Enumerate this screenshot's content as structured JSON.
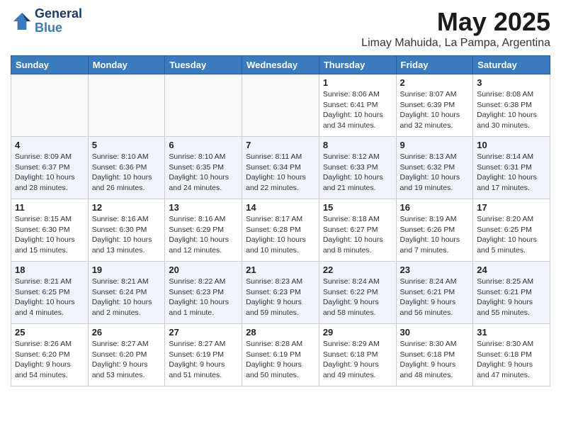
{
  "header": {
    "logo_line1": "General",
    "logo_line2": "Blue",
    "month_year": "May 2025",
    "location": "Limay Mahuida, La Pampa, Argentina"
  },
  "days_of_week": [
    "Sunday",
    "Monday",
    "Tuesday",
    "Wednesday",
    "Thursday",
    "Friday",
    "Saturday"
  ],
  "weeks": [
    [
      {
        "day": "",
        "info": ""
      },
      {
        "day": "",
        "info": ""
      },
      {
        "day": "",
        "info": ""
      },
      {
        "day": "",
        "info": ""
      },
      {
        "day": "1",
        "info": "Sunrise: 8:06 AM\nSunset: 6:41 PM\nDaylight: 10 hours\nand 34 minutes."
      },
      {
        "day": "2",
        "info": "Sunrise: 8:07 AM\nSunset: 6:39 PM\nDaylight: 10 hours\nand 32 minutes."
      },
      {
        "day": "3",
        "info": "Sunrise: 8:08 AM\nSunset: 6:38 PM\nDaylight: 10 hours\nand 30 minutes."
      }
    ],
    [
      {
        "day": "4",
        "info": "Sunrise: 8:09 AM\nSunset: 6:37 PM\nDaylight: 10 hours\nand 28 minutes."
      },
      {
        "day": "5",
        "info": "Sunrise: 8:10 AM\nSunset: 6:36 PM\nDaylight: 10 hours\nand 26 minutes."
      },
      {
        "day": "6",
        "info": "Sunrise: 8:10 AM\nSunset: 6:35 PM\nDaylight: 10 hours\nand 24 minutes."
      },
      {
        "day": "7",
        "info": "Sunrise: 8:11 AM\nSunset: 6:34 PM\nDaylight: 10 hours\nand 22 minutes."
      },
      {
        "day": "8",
        "info": "Sunrise: 8:12 AM\nSunset: 6:33 PM\nDaylight: 10 hours\nand 21 minutes."
      },
      {
        "day": "9",
        "info": "Sunrise: 8:13 AM\nSunset: 6:32 PM\nDaylight: 10 hours\nand 19 minutes."
      },
      {
        "day": "10",
        "info": "Sunrise: 8:14 AM\nSunset: 6:31 PM\nDaylight: 10 hours\nand 17 minutes."
      }
    ],
    [
      {
        "day": "11",
        "info": "Sunrise: 8:15 AM\nSunset: 6:30 PM\nDaylight: 10 hours\nand 15 minutes."
      },
      {
        "day": "12",
        "info": "Sunrise: 8:16 AM\nSunset: 6:30 PM\nDaylight: 10 hours\nand 13 minutes."
      },
      {
        "day": "13",
        "info": "Sunrise: 8:16 AM\nSunset: 6:29 PM\nDaylight: 10 hours\nand 12 minutes."
      },
      {
        "day": "14",
        "info": "Sunrise: 8:17 AM\nSunset: 6:28 PM\nDaylight: 10 hours\nand 10 minutes."
      },
      {
        "day": "15",
        "info": "Sunrise: 8:18 AM\nSunset: 6:27 PM\nDaylight: 10 hours\nand 8 minutes."
      },
      {
        "day": "16",
        "info": "Sunrise: 8:19 AM\nSunset: 6:26 PM\nDaylight: 10 hours\nand 7 minutes."
      },
      {
        "day": "17",
        "info": "Sunrise: 8:20 AM\nSunset: 6:25 PM\nDaylight: 10 hours\nand 5 minutes."
      }
    ],
    [
      {
        "day": "18",
        "info": "Sunrise: 8:21 AM\nSunset: 6:25 PM\nDaylight: 10 hours\nand 4 minutes."
      },
      {
        "day": "19",
        "info": "Sunrise: 8:21 AM\nSunset: 6:24 PM\nDaylight: 10 hours\nand 2 minutes."
      },
      {
        "day": "20",
        "info": "Sunrise: 8:22 AM\nSunset: 6:23 PM\nDaylight: 10 hours\nand 1 minute."
      },
      {
        "day": "21",
        "info": "Sunrise: 8:23 AM\nSunset: 6:23 PM\nDaylight: 9 hours\nand 59 minutes."
      },
      {
        "day": "22",
        "info": "Sunrise: 8:24 AM\nSunset: 6:22 PM\nDaylight: 9 hours\nand 58 minutes."
      },
      {
        "day": "23",
        "info": "Sunrise: 8:24 AM\nSunset: 6:21 PM\nDaylight: 9 hours\nand 56 minutes."
      },
      {
        "day": "24",
        "info": "Sunrise: 8:25 AM\nSunset: 6:21 PM\nDaylight: 9 hours\nand 55 minutes."
      }
    ],
    [
      {
        "day": "25",
        "info": "Sunrise: 8:26 AM\nSunset: 6:20 PM\nDaylight: 9 hours\nand 54 minutes."
      },
      {
        "day": "26",
        "info": "Sunrise: 8:27 AM\nSunset: 6:20 PM\nDaylight: 9 hours\nand 53 minutes."
      },
      {
        "day": "27",
        "info": "Sunrise: 8:27 AM\nSunset: 6:19 PM\nDaylight: 9 hours\nand 51 minutes."
      },
      {
        "day": "28",
        "info": "Sunrise: 8:28 AM\nSunset: 6:19 PM\nDaylight: 9 hours\nand 50 minutes."
      },
      {
        "day": "29",
        "info": "Sunrise: 8:29 AM\nSunset: 6:18 PM\nDaylight: 9 hours\nand 49 minutes."
      },
      {
        "day": "30",
        "info": "Sunrise: 8:30 AM\nSunset: 6:18 PM\nDaylight: 9 hours\nand 48 minutes."
      },
      {
        "day": "31",
        "info": "Sunrise: 8:30 AM\nSunset: 6:18 PM\nDaylight: 9 hours\nand 47 minutes."
      }
    ]
  ]
}
